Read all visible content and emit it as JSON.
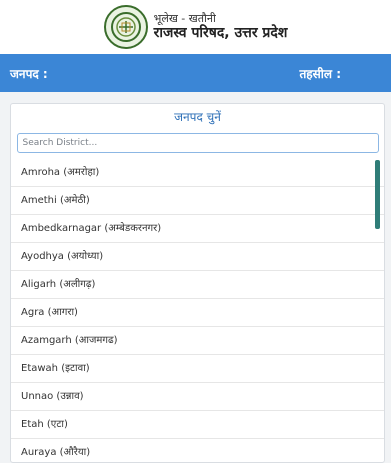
{
  "header": {
    "subtitle": "भूलेख - खतौनी",
    "title": "राजस्व परिषद, उत्तर प्रदेश"
  },
  "bar": {
    "district_label": "जनपद :",
    "tehsil_label": "तहसील :"
  },
  "panel": {
    "title": "जनपद चुनें",
    "search_placeholder": "Search District..."
  },
  "districts": [
    "Amroha (अमरोहा)",
    "Amethi (अमेठी)",
    "Ambedkarnagar (अम्बेडकरनगर)",
    "Ayodhya (अयोध्या)",
    "Aligarh (अलीगढ़)",
    "Agra (आगरा)",
    "Azamgarh (आजमगढ)",
    "Etawah (इटावा)",
    "Unnao (उन्नाव)",
    "Etah (एटा)",
    "Auraya (औरैया)"
  ],
  "colors": {
    "bar": "#3b86d6",
    "panel_title": "#2d6fb7",
    "scrollbar": "#2f7d78"
  },
  "icons": {
    "logo": "revenue-board-emblem-icon"
  }
}
